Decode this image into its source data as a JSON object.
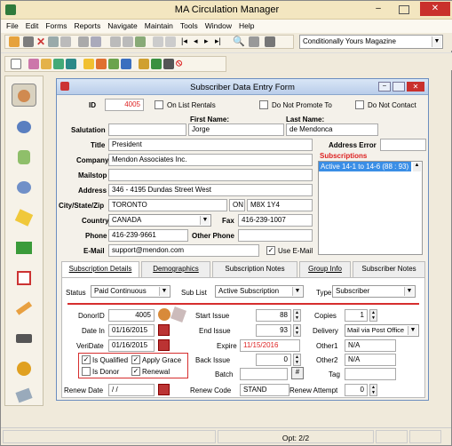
{
  "window": {
    "title": "MA Circulation Manager"
  },
  "menu": [
    "File",
    "Edit",
    "Forms",
    "Reports",
    "Navigate",
    "Maintain",
    "Tools",
    "Window",
    "Help"
  ],
  "toolbar": {
    "magazine_select": "Conditionally Yours Magazine"
  },
  "form": {
    "title": "Subscriber Data Entry Form",
    "id_label": "ID",
    "id_value": "4005",
    "on_list_rentals": "On List Rentals",
    "do_not_promote": "Do Not Promote To",
    "do_not_contact": "Do Not Contact",
    "salutation_label": "Salutation",
    "first_name_label": "First Name:",
    "first_name": "Jorge",
    "last_name_label": "Last Name:",
    "last_name": "de Mendonca",
    "title_label": "Title",
    "title_value": "President",
    "company_label": "Company",
    "company_value": "Mendon Associates Inc.",
    "mailstop_label": "Mailstop",
    "address_label": "Address",
    "address_value": "346 - 4195 Dundas Street West",
    "citystatezip_label": "City/State/Zip",
    "city": "TORONTO",
    "state": "ON",
    "zip": "M8X 1Y4",
    "country_label": "Country",
    "country": "CANADA",
    "fax_label": "Fax",
    "fax": "416-239-1007",
    "phone_label": "Phone",
    "phone": "416-239-9661",
    "other_phone_label": "Other Phone",
    "email_label": "E-Mail",
    "email": "support@mendon.com",
    "use_email": "Use E-Mail",
    "address_error_label": "Address Error",
    "subscriptions_label": "Subscriptions",
    "subscription_item": "Active 14-1 to 14-6 (88 : 93)",
    "tabs": [
      "Subscription Details",
      "Demographics",
      "Subscription Notes",
      "Group Info",
      "Subscriber Notes"
    ],
    "status_label": "Status",
    "status_value": "Paid Continuous",
    "sublist_label": "Sub List",
    "sublist_value": "Active Subscription",
    "type_label": "Type",
    "type_value": "Subscriber",
    "donor_label": "DonorID",
    "donor_value": "4005",
    "date_in_label": "Date In",
    "date_in": "01/16/2015",
    "veridate_label": "VeriDate",
    "veridate": "01/16/2015",
    "start_issue_label": "Start Issue",
    "start_issue": "88",
    "end_issue_label": "End Issue",
    "end_issue": "93",
    "expire_label": "Expire",
    "expire": "11/15/2016",
    "back_issue_label": "Back Issue",
    "back_issue": "0",
    "batch_label": "Batch",
    "copies_label": "Copies",
    "copies": "1",
    "delivery_label": "Delivery",
    "delivery": "Mail via Post Office",
    "other1_label": "Other1",
    "other1": "N/A",
    "other2_label": "Other2",
    "other2": "N/A",
    "tag_label": "Tag",
    "is_qualified": "Is Qualified",
    "apply_grace": "Apply Grace",
    "is_donor": "Is Donor",
    "renewal": "Renewal",
    "renew_date_label": "Renew Date",
    "renew_date": "/ /",
    "renew_code_label": "Renew Code",
    "renew_code": "STAND",
    "renew_attempt_label": "Renew Attempt",
    "renew_attempt": "0"
  },
  "status": {
    "text": "Opt: 2/2"
  },
  "colors": {
    "title_bar": "#f3e6c0",
    "accent_red": "#d62e2e",
    "form_title": "#c3d5ee",
    "selection": "#3a8ee6"
  }
}
